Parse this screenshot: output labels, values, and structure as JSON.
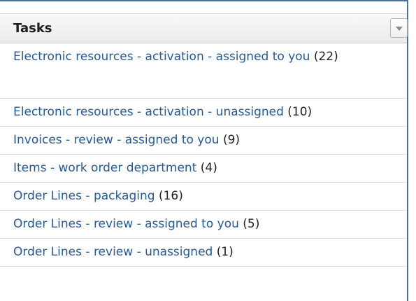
{
  "panel": {
    "title": "Tasks",
    "menu_icon": "chevron-down-icon"
  },
  "tasks": [
    {
      "label": "Electronic resources - activation - assigned to you",
      "count": "(22)"
    },
    {
      "label": "Electronic resources - activation - unassigned",
      "count": "(10)"
    },
    {
      "label": "Invoices - review - assigned to you",
      "count": "(9)"
    },
    {
      "label": "Items - work order department",
      "count": "(4)"
    },
    {
      "label": "Order Lines - packaging",
      "count": "(16)"
    },
    {
      "label": "Order Lines - review - assigned to you",
      "count": "(5)"
    },
    {
      "label": "Order Lines - review - unassigned",
      "count": "(1)"
    }
  ],
  "colors": {
    "link": "#245a9a",
    "border_accent": "#4d6f9b"
  }
}
